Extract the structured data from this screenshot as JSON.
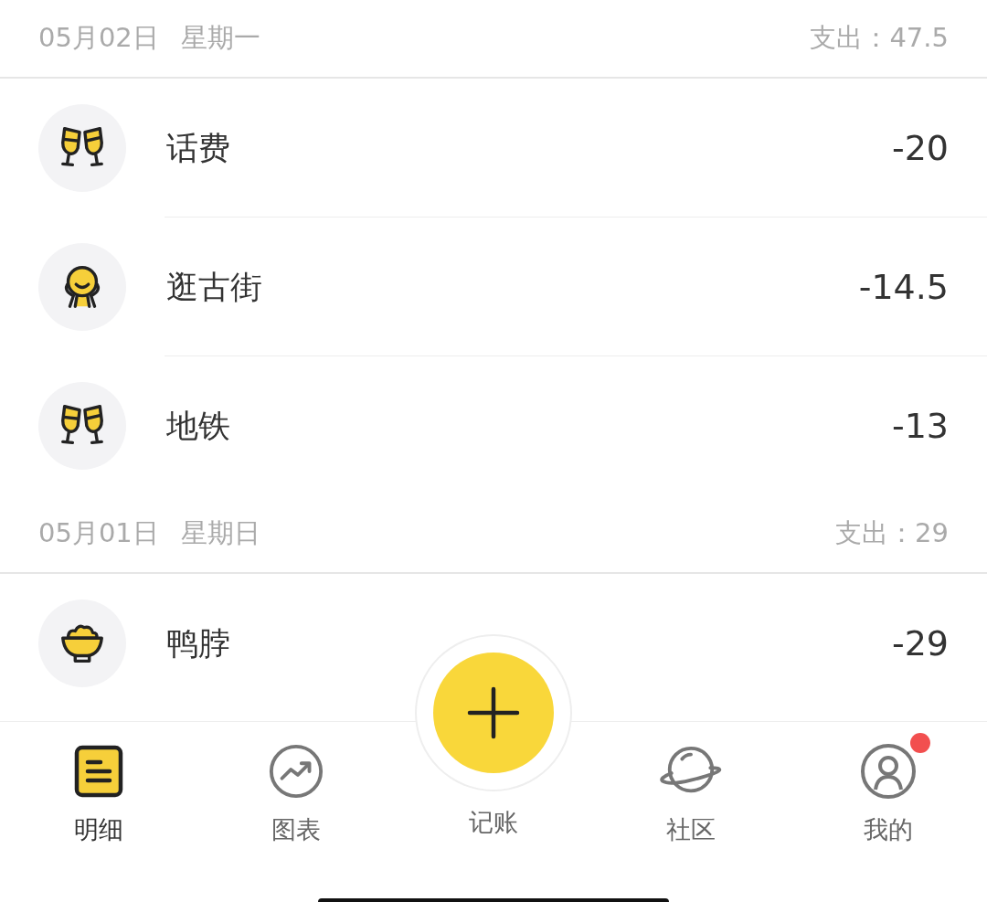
{
  "days": [
    {
      "date": "05月02日",
      "weekday": "星期一",
      "total": "支出：47.5",
      "items": [
        {
          "kind": "glasses",
          "name": "话费",
          "amount": "-20"
        },
        {
          "kind": "person",
          "name": "逛古街",
          "amount": "-14.5"
        },
        {
          "kind": "glasses",
          "name": "地铁",
          "amount": "-13"
        }
      ]
    },
    {
      "date": "05月01日",
      "weekday": "星期日",
      "total": "支出：29",
      "items": [
        {
          "kind": "bowl",
          "name": "鸭脖",
          "amount": "-29"
        }
      ]
    }
  ],
  "tabs": [
    {
      "kind": "list",
      "label": "明细",
      "selected": true,
      "badge": false
    },
    {
      "kind": "chart",
      "label": "图表",
      "selected": false,
      "badge": false
    },
    {
      "kind": "add",
      "label": "记账",
      "selected": false,
      "badge": false
    },
    {
      "kind": "planet",
      "label": "社区",
      "selected": false,
      "badge": false
    },
    {
      "kind": "user",
      "label": "我的",
      "selected": false,
      "badge": true
    }
  ]
}
